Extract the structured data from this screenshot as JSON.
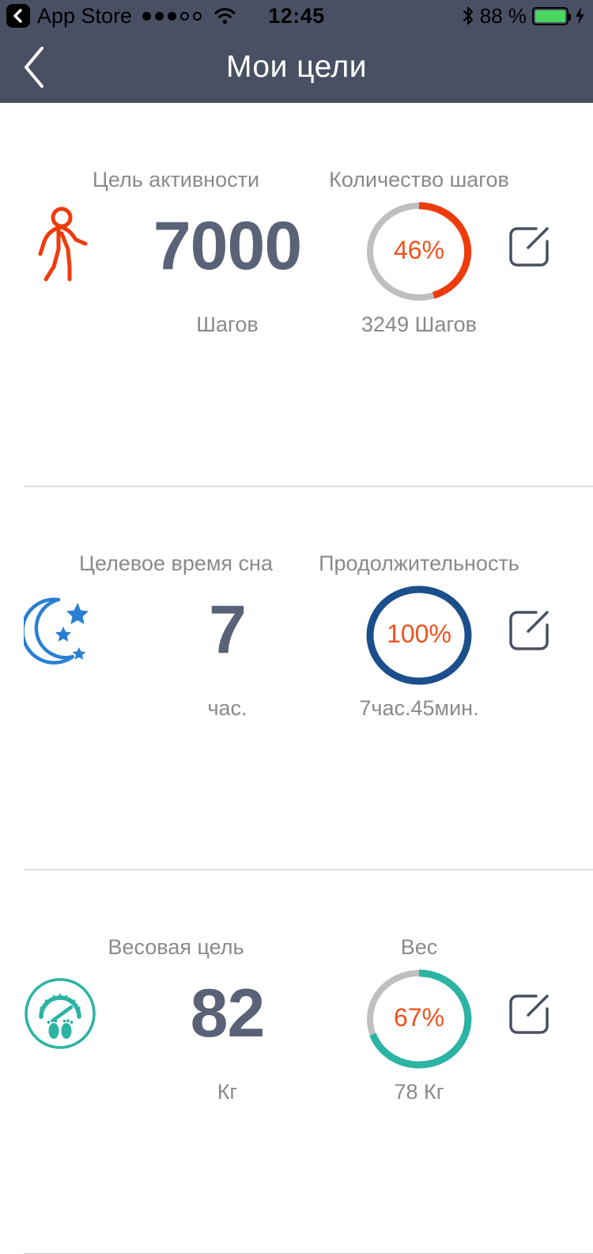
{
  "statusbar": {
    "back_badge_icon": "chevron-left-badge-icon",
    "carrier_label": "App Store",
    "signal_dots_total": 5,
    "signal_dots_filled": 3,
    "wifi_icon": "wifi-icon",
    "time": "12:45",
    "bluetooth_icon": "bluetooth-icon",
    "battery_text": "88 %",
    "battery_percent": 88,
    "battery_color": "#4cd662",
    "charging_icon": "lightning-bolt-icon"
  },
  "navbar": {
    "back_icon": "chevron-left-icon",
    "title": "Мои цели",
    "background": "#4a5064"
  },
  "colors": {
    "accent_orange": "#f0521c",
    "ring_orange": "#ee3b0c",
    "ring_blue": "#1b4f8c",
    "ring_teal": "#2bb3a3",
    "value_slate": "#5a6278",
    "label_gray": "#8a8a8a",
    "track_gray": "#bfbfbf"
  },
  "goals": [
    {
      "id": "activity",
      "icon": "walking-person-icon",
      "icon_color": "#ee3b0c",
      "goal_label": "Цель активности",
      "goal_value": "7000",
      "goal_unit": "Шагов",
      "progress_label": "Количество шагов",
      "progress_percent_text": "46%",
      "progress_percent": 46,
      "progress_color": "#ee3b0c",
      "progress_sub": "3249 Шагов",
      "edit_icon": "edit-pencil-icon"
    },
    {
      "id": "sleep",
      "icon": "moon-stars-icon",
      "icon_color": "#2a7fd4",
      "goal_label": "Целевое время сна",
      "goal_value": "7",
      "goal_unit": "час.",
      "progress_label": "Продолжительность",
      "progress_percent_text": "100%",
      "progress_percent": 100,
      "progress_color": "#1b4f8c",
      "progress_sub": "7час.45мин.",
      "edit_icon": "edit-pencil-icon"
    },
    {
      "id": "weight",
      "icon": "weight-scale-icon",
      "icon_color": "#2bb3a3",
      "goal_label": "Весовая цель",
      "goal_value": "82",
      "goal_unit": "Кг",
      "progress_label": "Вес",
      "progress_percent_text": "67%",
      "progress_percent": 67,
      "progress_color": "#2bb3a3",
      "progress_sub": "78 Кг",
      "edit_icon": "edit-pencil-icon"
    }
  ]
}
